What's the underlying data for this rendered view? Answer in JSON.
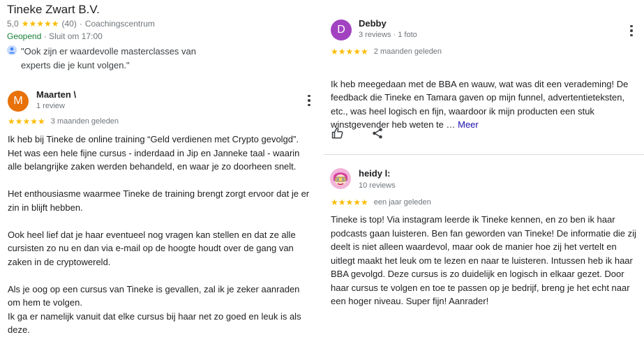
{
  "business": {
    "name": "Tineke Zwart B.V.",
    "rating": "5,0",
    "stars": "★★★★★",
    "review_count": "(40)",
    "category": "Coachingscentrum",
    "status_open": "Geopend",
    "status_hours": "Sluit om 17:00",
    "quote": "\"Ook zijn er waardevolle masterclasses van experts die je kunt volgen.\""
  },
  "reviews": [
    {
      "avatar_letter": "M",
      "avatar_color": "#e8710a",
      "name": "Maarten \\",
      "meta": "1 review",
      "stars": "★★★★★",
      "date": "3 maanden geleden",
      "text": "Ik heb bij Tineke de online training “Geld verdienen met Crypto gevolgd”.\nHet was een hele fijne cursus - inderdaad in Jip en Janneke taal - waarin alle belangrijke zaken werden behandeld, en waar je zo doorheen snelt.\n\nHet enthousiasme waarmee Tineke de training brengt zorgt ervoor dat je er zin in blijft hebben.\n\nOok heel lief dat je haar eventueel nog vragen kan stellen en dat ze alle cursisten zo nu en dan via e-mail op de hoogte houdt over de gang van zaken in de cryptowereld.\n\nAls je oog op een cursus van Tineke is gevallen, zal ik je zeker aanraden om hem te volgen.\nIk ga er namelijk vanuit dat elke cursus bij haar net zo goed en leuk is als deze."
    },
    {
      "avatar_letter": "D",
      "avatar_color": "#a142c1",
      "name": "Debby",
      "meta": "3 reviews · 1 foto",
      "stars": "★★★★★",
      "date": "2 maanden geleden",
      "text": "Ik heb meegedaan met de BBA en wauw, wat was dit een verademing! De feedback die Tineke en Tamara gaven op mijn funnel, advertentieteksten, etc., was heel logisch en fijn, waardoor ik mijn producten een stuk winstgevender heb weten te … ",
      "more": "Meer"
    },
    {
      "name": "heidy l:",
      "meta": "10 reviews",
      "stars": "★★★★★",
      "date": "een jaar geleden",
      "text": "Tineke is top! Via instagram leerde ik Tineke kennen, en zo ben ik haar podcasts gaan luisteren. Ben fan geworden van Tineke! De informatie die zij deelt is niet alleen waardevol, maar ook de manier hoe zij het vertelt en uitlegt maakt het leuk om te lezen en naar te luisteren. Intussen heb ik haar BBA gevolgd. Deze cursus is zo duidelijk en logisch in elkaar gezet. Door haar cursus te volgen en toe te passen op je bedrijf, breng je het echt naar een hoger niveau. Super fijn! Aanrader!"
    }
  ]
}
